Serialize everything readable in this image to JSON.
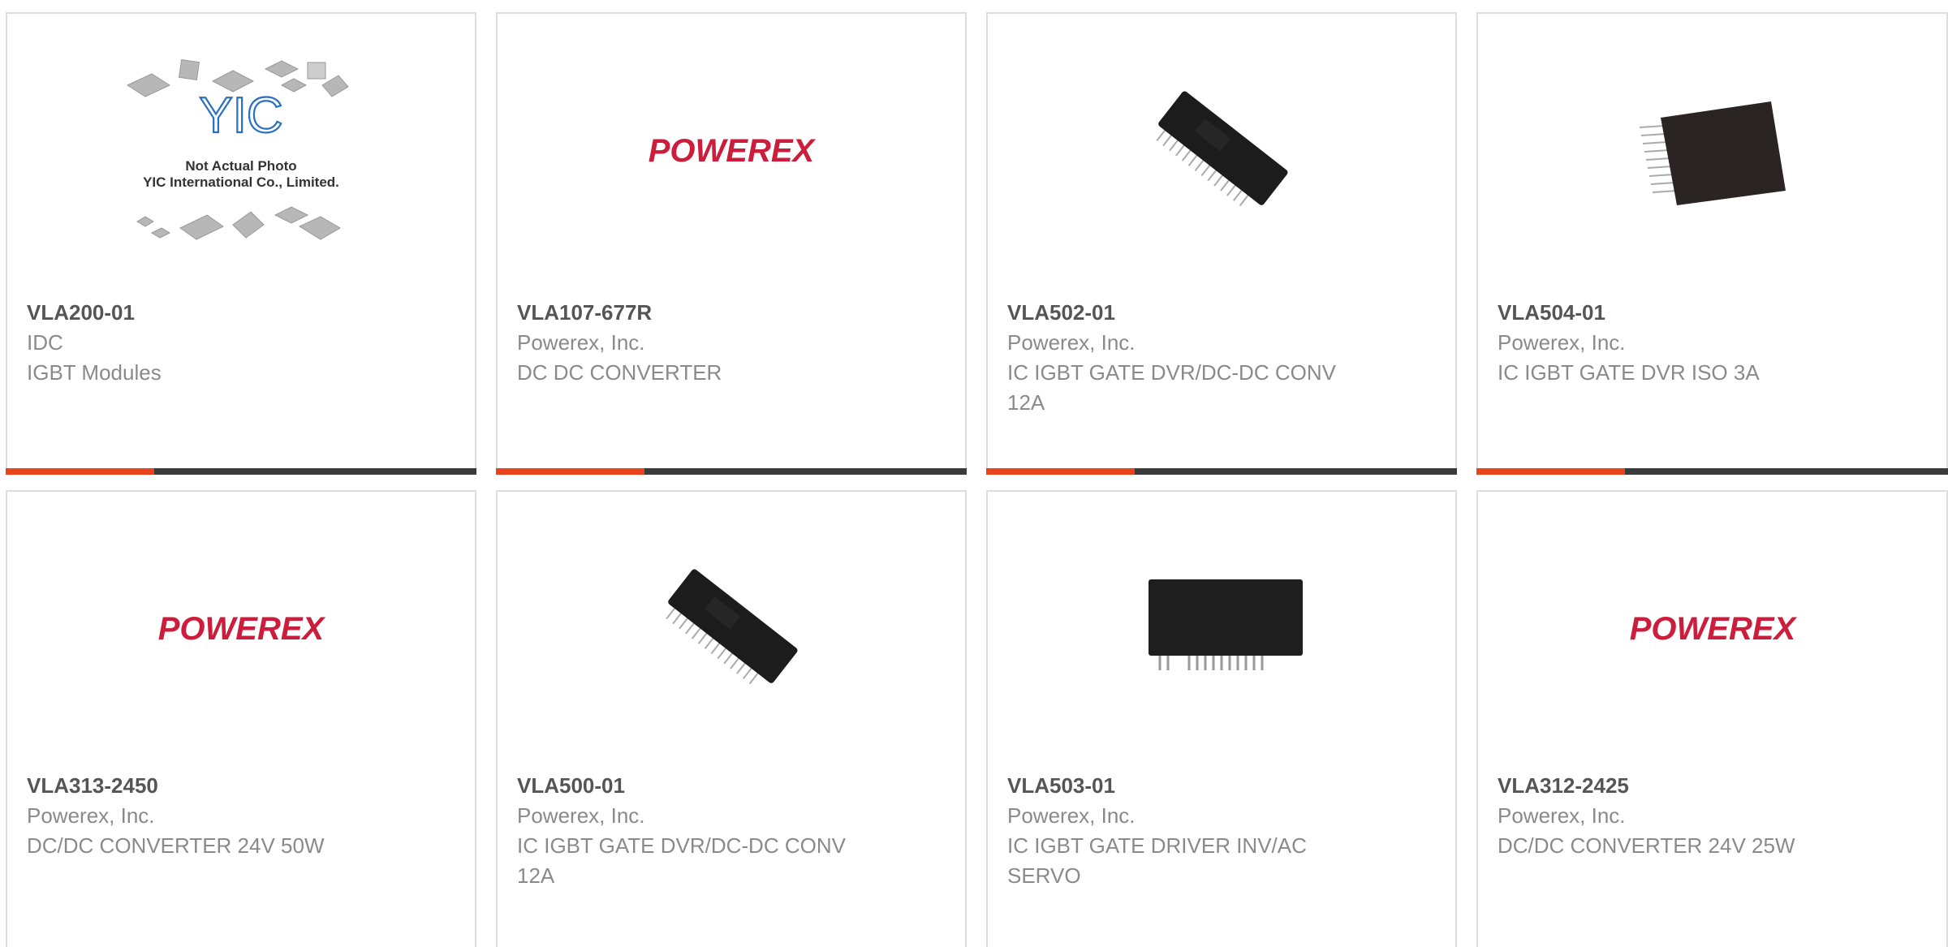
{
  "colors": {
    "accent": "#e8431c",
    "bar_dark": "#3b3b3b",
    "powerex_red": "#cc1e3c",
    "yic_blue": "#2a6fc0"
  },
  "cards": [
    {
      "part_number": "VLA200-01",
      "manufacturer": "IDC",
      "description": "IGBT Modules",
      "image": "yic-placeholder",
      "photo_note": {
        "line1": "Not Actual Photo",
        "line2": "YIC International Co., Limited."
      },
      "logo_text": "YIC"
    },
    {
      "part_number": "VLA107-677R",
      "manufacturer": "Powerex, Inc.",
      "description": "DC DC CONVERTER",
      "image": "powerex-logo",
      "logo_text": "POWEREX"
    },
    {
      "part_number": "VLA502-01",
      "manufacturer": "Powerex, Inc.",
      "description": "IC IGBT GATE DVR/DC-DC CONV 12A",
      "image": "chip-diagonal"
    },
    {
      "part_number": "VLA504-01",
      "manufacturer": "Powerex, Inc.",
      "description": "IC IGBT GATE DVR ISO 3A",
      "image": "chip-slanted-sip"
    },
    {
      "part_number": "VLA313-2450",
      "manufacturer": "Powerex, Inc.",
      "description": "DC/DC CONVERTER 24V 50W",
      "image": "powerex-logo",
      "logo_text": "POWEREX"
    },
    {
      "part_number": "VLA500-01",
      "manufacturer": "Powerex, Inc.",
      "description": "IC IGBT GATE DVR/DC-DC CONV 12A",
      "image": "chip-diagonal"
    },
    {
      "part_number": "VLA503-01",
      "manufacturer": "Powerex, Inc.",
      "description": "IC IGBT GATE DRIVER INV/AC SERVO",
      "image": "chip-sip-front"
    },
    {
      "part_number": "VLA312-2425",
      "manufacturer": "Powerex, Inc.",
      "description": "DC/DC CONVERTER 24V 25W",
      "image": "powerex-logo",
      "logo_text": "POWEREX"
    }
  ]
}
